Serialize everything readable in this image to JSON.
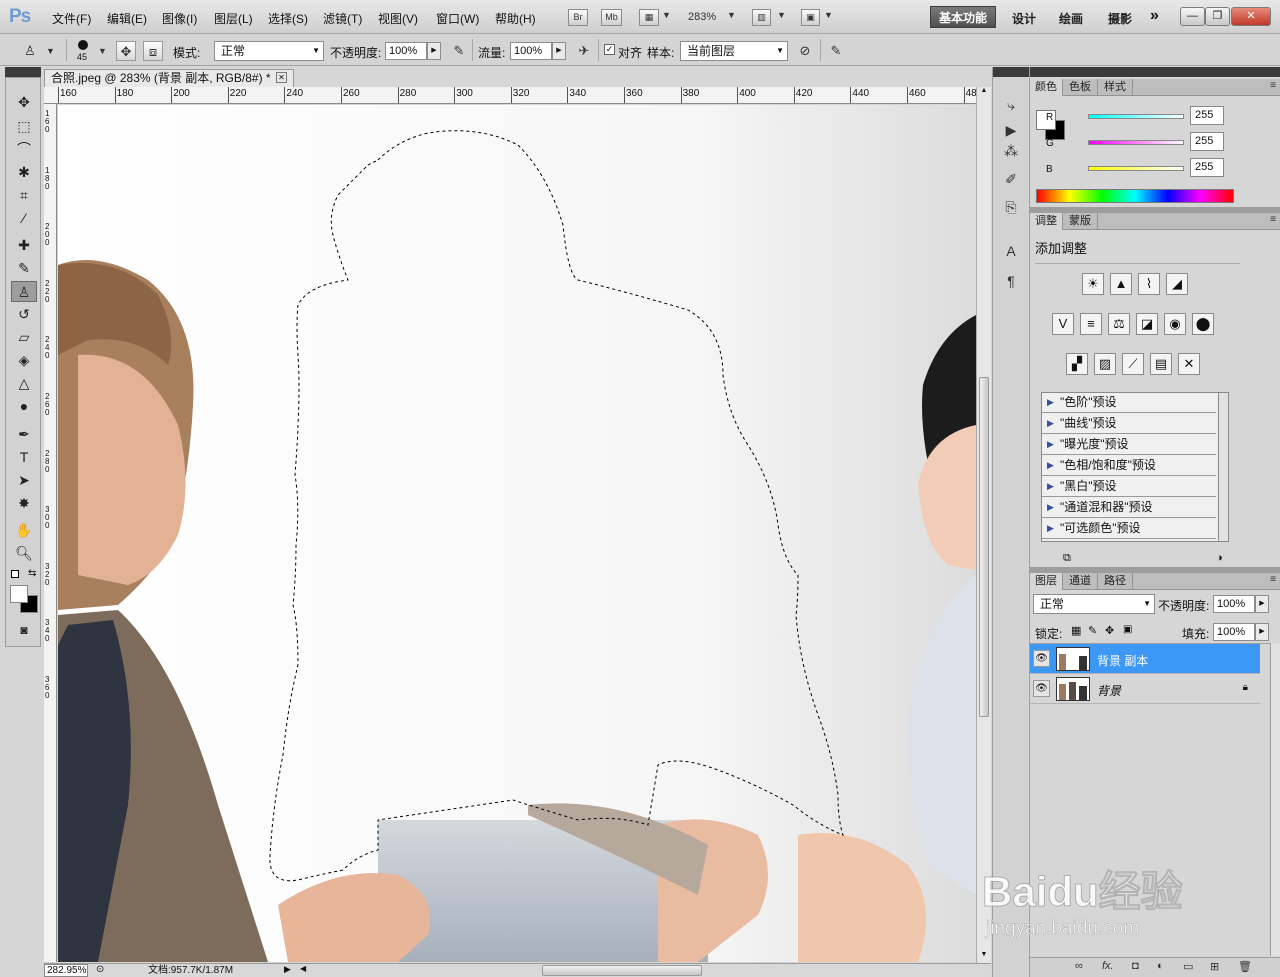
{
  "app": {
    "logo": "Ps"
  },
  "menu": {
    "items": [
      "文件(F)",
      "编辑(E)",
      "图像(I)",
      "图层(L)",
      "选择(S)",
      "滤镜(T)",
      "视图(V)",
      "窗口(W)",
      "帮助(H)"
    ],
    "bridge": "Br",
    "mini_bridge": "Mb",
    "zoom": "283%"
  },
  "workspace": {
    "active": "基本功能",
    "items": [
      "设计",
      "绘画",
      "摄影"
    ],
    "more": "»"
  },
  "window_controls": {
    "minimize": "—",
    "restore": "❐",
    "close": "✕"
  },
  "options": {
    "brush_size": "45",
    "mode_label": "模式:",
    "mode_value": "正常",
    "opacity_label": "不透明度:",
    "opacity_value": "100%",
    "flow_label": "流量:",
    "flow_value": "100%",
    "align_label": "对齐",
    "align_checked": "✓",
    "sample_label": "样本:",
    "sample_value": "当前图层"
  },
  "document": {
    "tab_title": "合照.jpeg @ 283% (背景 副本, RGB/8#) *",
    "ruler_top": [
      "160",
      "180",
      "200",
      "220",
      "240",
      "260",
      "280",
      "300",
      "320",
      "340",
      "360",
      "380",
      "400",
      "420",
      "440",
      "460",
      "48"
    ],
    "ruler_left": [
      "1 6 0",
      "1 8 0",
      "2 0 0",
      "2 2 0",
      "2 4 0",
      "2 6 0",
      "2 8 0",
      "3 0 0",
      "3 2 0",
      "3 4 0",
      "3 6 0"
    ],
    "zoom_status": "282.95%",
    "doc_size": "文档:957.7K/1.87M"
  },
  "panels": {
    "color": {
      "tabs": [
        "颜色",
        "色板",
        "样式"
      ],
      "channels": [
        {
          "name": "R",
          "value": "255"
        },
        {
          "name": "G",
          "value": "255"
        },
        {
          "name": "B",
          "value": "255"
        }
      ]
    },
    "adjustments": {
      "tabs": [
        "调整",
        "蒙版"
      ],
      "title": "添加调整",
      "presets": [
        "\"色阶\"预设",
        "\"曲线\"预设",
        "\"曝光度\"预设",
        "\"色相/饱和度\"预设",
        "\"黑白\"预设",
        "\"通道混和器\"预设",
        "\"可选颜色\"预设"
      ]
    },
    "layers": {
      "tabs": [
        "图层",
        "通道",
        "路径"
      ],
      "blend_mode": "正常",
      "opacity_label": "不透明度:",
      "opacity_value": "100%",
      "lock_label": "锁定:",
      "fill_label": "填充:",
      "fill_value": "100%",
      "items": [
        {
          "name": "背景 副本",
          "selected": true
        },
        {
          "name": "背景",
          "locked": true
        }
      ],
      "footer_fx": "fx."
    }
  },
  "watermark": {
    "text": "Baidu经验",
    "url": "jingyan.baidu.com"
  },
  "colors": {
    "accent": "#3d97f5",
    "workspace_bg": "#d6d6d6",
    "panel_dark": "#3b3b3b",
    "close_red": "#c0392b"
  }
}
